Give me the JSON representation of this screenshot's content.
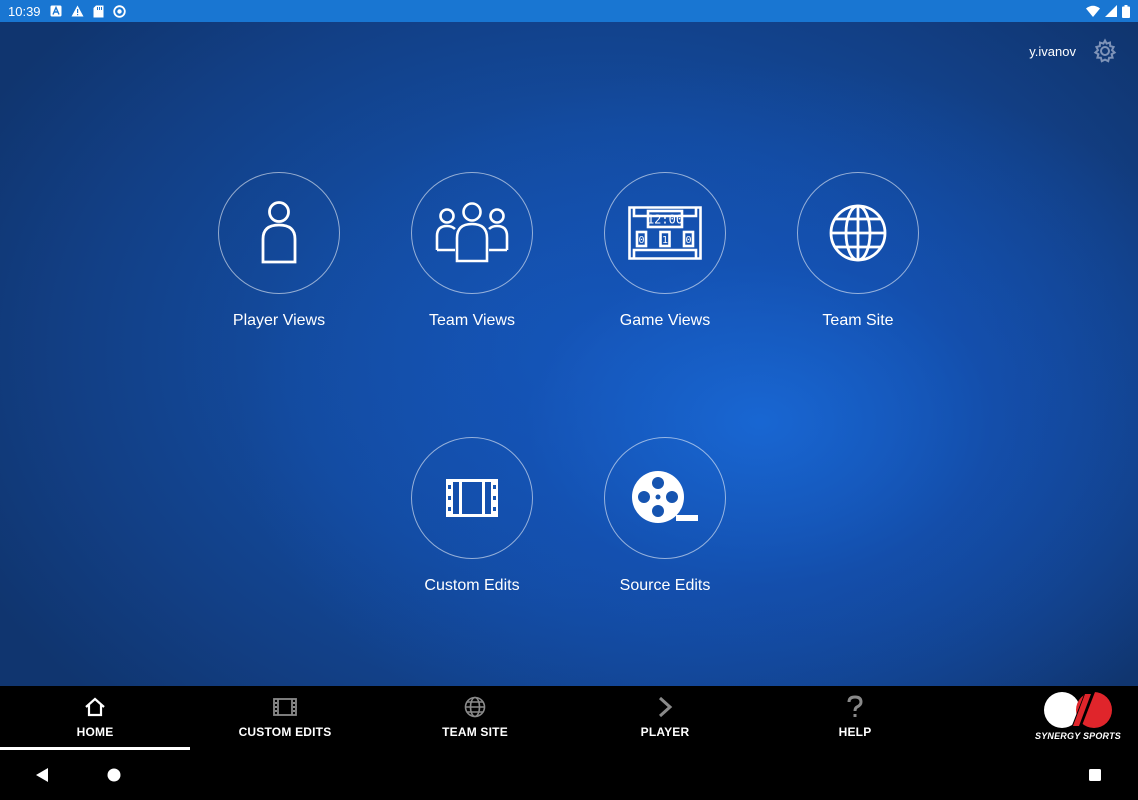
{
  "status_bar": {
    "time": "10:39",
    "left_icons": [
      "a-badge-icon",
      "warning-icon",
      "sd-card-icon",
      "sync-icon"
    ],
    "right_icons": [
      "wifi-icon",
      "signal-icon",
      "battery-icon"
    ]
  },
  "header": {
    "username": "y.ivanov",
    "settings_icon": "gear-icon"
  },
  "tiles": [
    {
      "label": "Player Views",
      "icon": "person-icon"
    },
    {
      "label": "Team Views",
      "icon": "group-icon"
    },
    {
      "label": "Game Views",
      "icon": "scoreboard-icon"
    },
    {
      "label": "Team Site",
      "icon": "globe-icon"
    },
    {
      "label": "Custom Edits",
      "icon": "film-strip-icon"
    },
    {
      "label": "Source Edits",
      "icon": "film-reel-icon"
    }
  ],
  "scoreboard_icon_text": {
    "clock": "12:00",
    "left": "0",
    "mid": "1",
    "right": "0"
  },
  "tabbar": {
    "tabs": [
      {
        "label": "HOME",
        "icon": "home-icon",
        "active": true
      },
      {
        "label": "CUSTOM EDITS",
        "icon": "film-strip-icon",
        "active": false
      },
      {
        "label": "TEAM SITE",
        "icon": "globe-icon",
        "active": false
      },
      {
        "label": "PLAYER",
        "icon": "chevron-right-icon",
        "active": false
      },
      {
        "label": "HELP",
        "icon": "question-icon",
        "active": false
      }
    ],
    "brand": "SYNERGY SPORTS"
  },
  "colors": {
    "status_bar": "#1976d2",
    "background_center": "#1654b0",
    "background_edge": "#10356f",
    "brand_red": "#e0252b",
    "inactive_icon": "#8a8a8a"
  },
  "navbar": {
    "buttons": [
      "back-icon",
      "home-circle-icon",
      "recents-square-icon"
    ]
  }
}
